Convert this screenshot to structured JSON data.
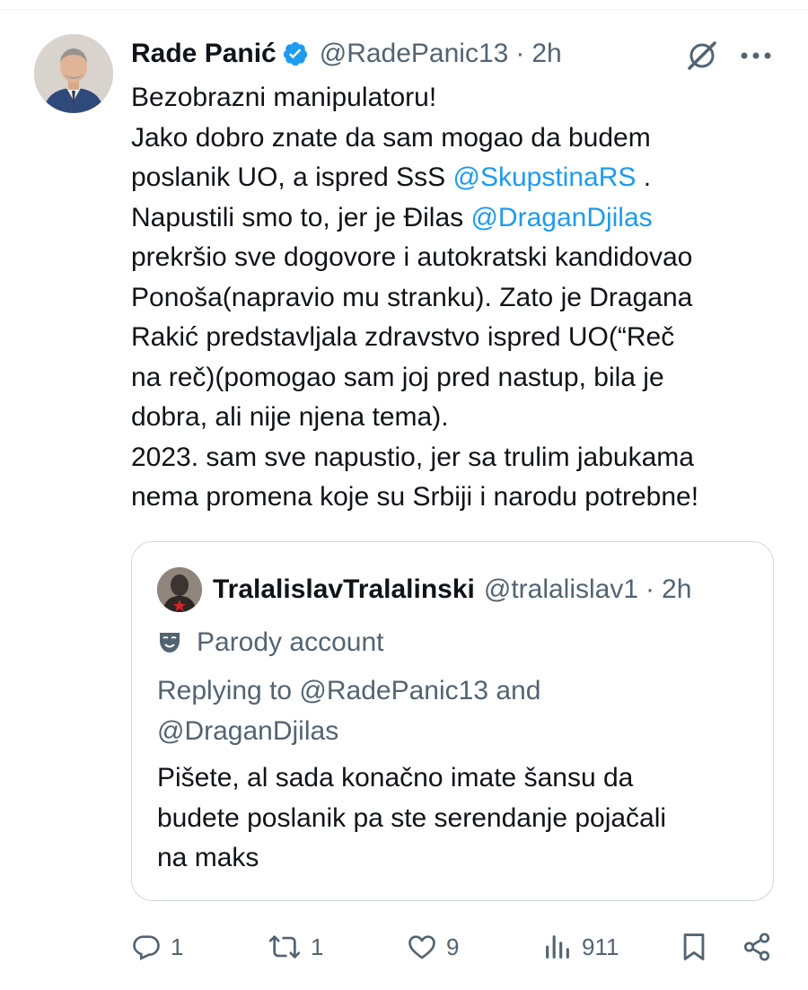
{
  "tweet": {
    "display_name": "Rade Panić",
    "handle": "@RadePanic13",
    "separator": "·",
    "time": "2h",
    "text_lines": [
      [
        {
          "t": "Bezobrazni manipulatoru!"
        }
      ],
      [
        {
          "t": "Jako dobro znate da sam mogao da budem"
        }
      ],
      [
        {
          "t": "poslanik UO, a ispred SsS "
        },
        {
          "t": "@SkupstinaRS",
          "mention": true
        },
        {
          "t": " ."
        }
      ],
      [
        {
          "t": "Napustili smo to, jer je Đilas "
        },
        {
          "t": "@DraganDjilas",
          "mention": true
        }
      ],
      [
        {
          "t": "prekršio sve dogovore i autokratski kandidovao"
        }
      ],
      [
        {
          "t": "Ponoša(napravio mu stranku). Zato je Dragana"
        }
      ],
      [
        {
          "t": "Rakić predstavljala zdravstvo ispred UO(“Reč"
        }
      ],
      [
        {
          "t": "na reč)(pomogao sam joj pred nastup, bila je"
        }
      ],
      [
        {
          "t": "dobra, ali nije njena tema)."
        }
      ],
      [
        {
          "t": "2023. sam sve napustio, jer sa trulim jabukama"
        }
      ],
      [
        {
          "t": "nema promena koje su Srbiji i narodu potrebne!"
        }
      ]
    ]
  },
  "quote": {
    "display_name": "TralalislavTralalinski",
    "handle": "@tralalislav1",
    "separator": "·",
    "time": "2h",
    "parody_label": "Parody account",
    "replying_lines": [
      "Replying to @RadePanic13 and",
      "@DraganDjilas"
    ],
    "text_lines": [
      "Pišete, al sada konačno imate šansu da",
      "budete poslanik pa ste serendanje pojačali",
      "na maks"
    ]
  },
  "actions": {
    "replies": "1",
    "reposts": "1",
    "likes": "9",
    "views": "911"
  },
  "icons": {
    "verified": "verified-badge-icon",
    "grok": "grok-icon",
    "more": "more-icon",
    "parody": "theater-mask-icon",
    "reply": "reply-icon",
    "repost": "repost-icon",
    "like": "heart-icon",
    "views": "views-icon",
    "bookmark": "bookmark-icon",
    "share": "share-icon"
  },
  "colors": {
    "accent": "#1d9bf0",
    "text": "#0f1419",
    "secondary": "#536471",
    "border": "#cfd9de"
  }
}
